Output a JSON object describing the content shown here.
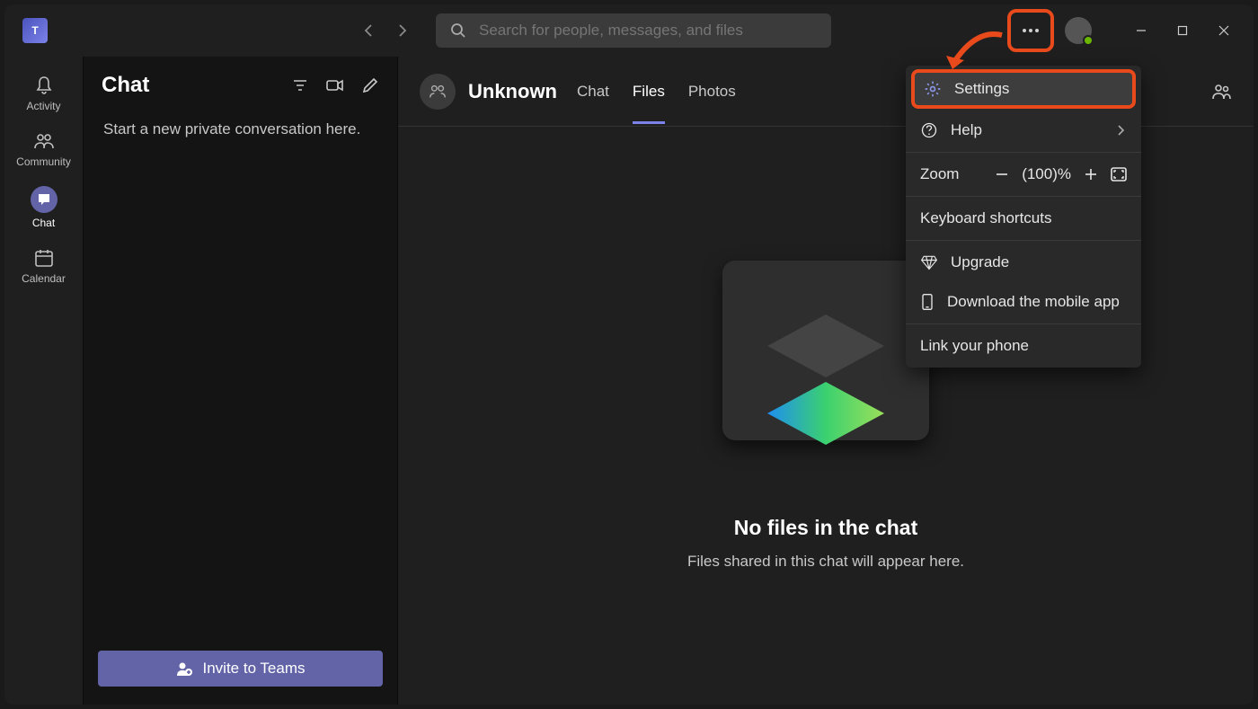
{
  "titlebar": {
    "search_placeholder": "Search for people, messages, and files"
  },
  "rail": {
    "items": [
      {
        "label": "Activity"
      },
      {
        "label": "Community"
      },
      {
        "label": "Chat"
      },
      {
        "label": "Calendar"
      }
    ]
  },
  "chatlist": {
    "title": "Chat",
    "empty_text": "Start a new private conversation here.",
    "invite_label": "Invite to Teams"
  },
  "main": {
    "contact_name": "Unknown",
    "tabs": [
      {
        "label": "Chat"
      },
      {
        "label": "Files"
      },
      {
        "label": "Photos"
      }
    ],
    "empty_title": "No files in the chat",
    "empty_sub": "Files shared in this chat will appear here."
  },
  "menu": {
    "settings": "Settings",
    "help": "Help",
    "zoom_label": "Zoom",
    "zoom_value": "(100)%",
    "shortcuts": "Keyboard shortcuts",
    "upgrade": "Upgrade",
    "download": "Download the mobile app",
    "link_phone": "Link your phone"
  }
}
